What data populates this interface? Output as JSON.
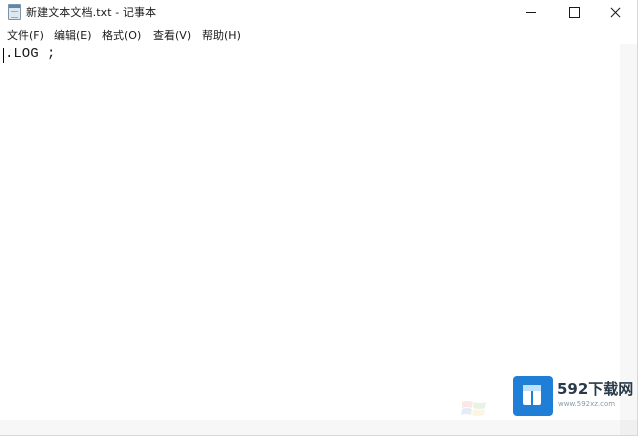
{
  "window": {
    "title": "新建文本文档.txt - 记事本"
  },
  "menu": {
    "file": "文件(F)",
    "edit": "编辑(E)",
    "format": "格式(O)",
    "view": "查看(V)",
    "help": "帮助(H)"
  },
  "editor": {
    "content": ".LOG ;"
  },
  "watermark": {
    "title": "592下载网",
    "url": "www.592xz.com",
    "accent_color": "#1f7fd6"
  },
  "icons": {
    "app": "notepad-icon",
    "minimize": "minimize-icon",
    "maximize": "maximize-icon",
    "close": "close-icon"
  }
}
